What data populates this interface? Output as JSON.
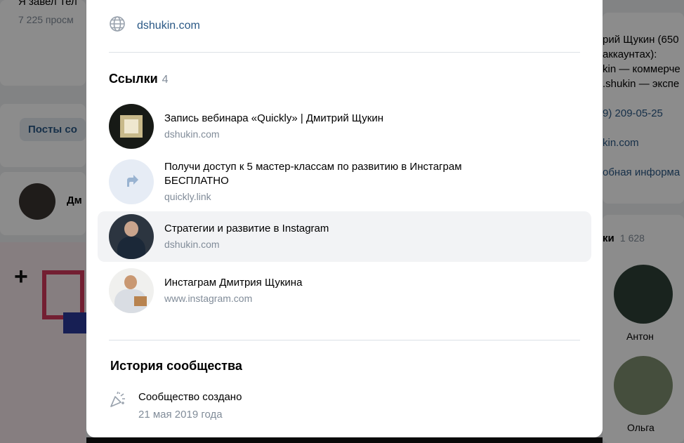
{
  "background": {
    "post_line1": "Я завел Тел",
    "post_views": "7 225 просм",
    "posts_tab": "Посты со",
    "author_name": "Дм",
    "right_info": [
      "рий Щукин (650",
      "аккаунтах):",
      "kin — коммерче",
      ".shukin — экспе",
      "9) 209-05-25",
      "kin.com",
      "обная информа"
    ],
    "members_title": "ки",
    "members_count": "1 628",
    "member1": "Антон",
    "member2": "Ольга"
  },
  "modal": {
    "website": "dshukin.com",
    "links_title": "Ссылки",
    "links_count": "4",
    "links": [
      {
        "title": "Запись вебинара «Quickly» | Дмитрий Щукин",
        "domain": "dshukin.com"
      },
      {
        "title": "Получи доступ к 5 мастер-классам по развитию в Инстаграм БЕСПЛАТНО",
        "domain": "quickly.link"
      },
      {
        "title": "Стратегии и развитие в Instagram",
        "domain": "dshukin.com"
      },
      {
        "title": "Инстаграм Дмитрия Щукина",
        "domain": "www.instagram.com"
      }
    ],
    "history_title": "История сообщества",
    "history_event": "Сообщество создано",
    "history_date": "21 мая 2019 года"
  },
  "colors": {
    "link": "#2a5885",
    "muted": "#818c99",
    "divider": "#dce1e6",
    "hover": "#f2f3f5"
  },
  "icons": [
    "globe-icon",
    "arrow-share-icon",
    "party-popper-icon"
  ]
}
